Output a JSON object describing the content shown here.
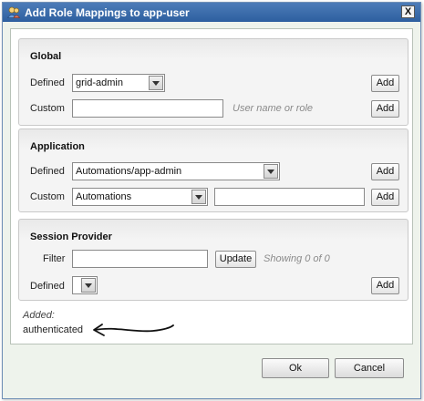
{
  "dialog": {
    "title": "Add Role Mappings to app-user",
    "close_label": "X"
  },
  "global": {
    "title": "Global",
    "defined_label": "Defined",
    "defined_value": "grid-admin",
    "custom_label": "Custom",
    "custom_value": "",
    "custom_hint": "User name or role",
    "add_label": "Add"
  },
  "application": {
    "title": "Application",
    "defined_label": "Defined",
    "defined_value": "Automations/app-admin",
    "custom_label": "Custom",
    "custom_select_value": "Automations",
    "custom_value": "",
    "add_label": "Add"
  },
  "session_provider": {
    "title": "Session Provider",
    "filter_label": "Filter",
    "filter_value": "",
    "update_label": "Update",
    "status": "Showing 0 of 0",
    "defined_label": "Defined",
    "defined_value": "",
    "add_label": "Add"
  },
  "added": {
    "label": "Added:",
    "items": [
      "authenticated"
    ]
  },
  "footer": {
    "ok_label": "Ok",
    "cancel_label": "Cancel"
  }
}
